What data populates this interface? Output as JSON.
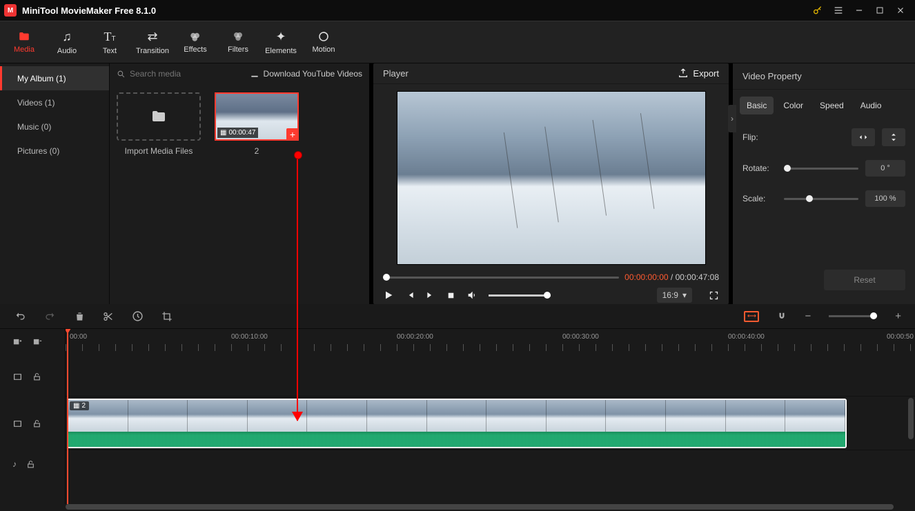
{
  "app": {
    "title": "MiniTool MovieMaker Free 8.1.0"
  },
  "toolbar": {
    "media": "Media",
    "audio": "Audio",
    "text": "Text",
    "transition": "Transition",
    "effects": "Effects",
    "filters": "Filters",
    "elements": "Elements",
    "motion": "Motion"
  },
  "sidebar": {
    "items": [
      {
        "label": "My Album (1)"
      },
      {
        "label": "Videos (1)"
      },
      {
        "label": "Music (0)"
      },
      {
        "label": "Pictures (0)"
      }
    ]
  },
  "media": {
    "search_placeholder": "Search media",
    "download": "Download YouTube Videos",
    "import_label": "Import Media Files",
    "clip_duration": "00:00:47",
    "clip_name": "2"
  },
  "player": {
    "title": "Player",
    "export": "Export",
    "current": "00:00:00:00",
    "total": "00:00:47:08",
    "aspect": "16:9"
  },
  "props": {
    "title": "Video Property",
    "tabs": {
      "basic": "Basic",
      "color": "Color",
      "speed": "Speed",
      "audio": "Audio"
    },
    "flip": "Flip:",
    "rotate": "Rotate:",
    "rotate_val": "0 °",
    "scale": "Scale:",
    "scale_val": "100 %",
    "reset": "Reset"
  },
  "timeline": {
    "ticks": [
      "00:00",
      "00:00:10:00",
      "00:00:20:00",
      "00:00:30:00",
      "00:00:40:00",
      "00:00:50"
    ],
    "clip_label": "2"
  }
}
